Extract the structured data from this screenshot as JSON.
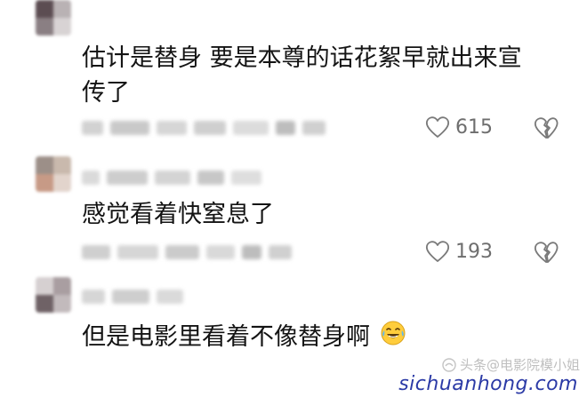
{
  "comments": [
    {
      "text_line1": "估计是替身 要是本尊的话花絮早就出来宣",
      "text_line2": "传了",
      "likes": "615"
    },
    {
      "text": "感觉看着快窒息了",
      "likes": "193"
    },
    {
      "text": "但是电影里看着不像替身啊"
    }
  ],
  "icons": {
    "like": "heart-outline-icon",
    "dislike": "broken-heart-icon",
    "emoji": "laughing-crying-emoji-icon",
    "watermark": "wechat-channel-icon"
  },
  "watermark": {
    "account": "头条@电影院模小姐",
    "site": "sichuanhong.com"
  },
  "colors": {
    "text": "#141414",
    "meta": "#6e6e6e",
    "site": "#2b3aa6"
  }
}
